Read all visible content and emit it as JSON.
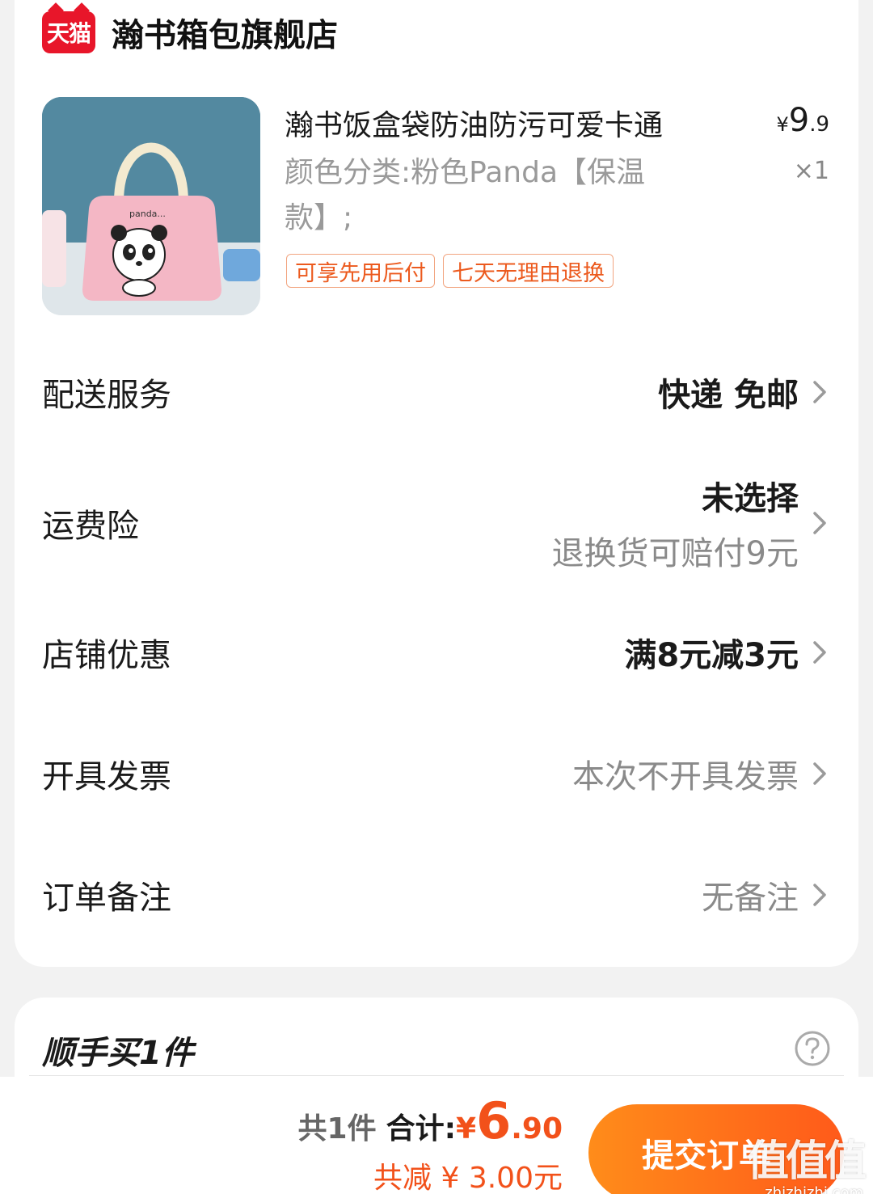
{
  "store": {
    "badge": "天猫",
    "name": "瀚书箱包旗舰店"
  },
  "product": {
    "title": "瀚书饭盒袋防油防污可爱卡通",
    "variant": "颜色分类:粉色Panda【保温款】;",
    "price_symbol": "¥",
    "price_int": "9",
    "price_dec": ".9",
    "quantity": "×1",
    "tags": [
      "可享先用后付",
      "七天无理由退换"
    ]
  },
  "rows": {
    "delivery": {
      "label": "配送服务",
      "value": "快递 免邮"
    },
    "insurance": {
      "label": "运费险",
      "value": "未选择",
      "sub": "退换货可赔付9元"
    },
    "discount": {
      "label": "店铺优惠",
      "value": "满8元减3元"
    },
    "invoice": {
      "label": "开具发票",
      "value": "本次不开具发票"
    },
    "note": {
      "label": "订单备注",
      "value": "无备注"
    }
  },
  "extra": {
    "title": "顺手买1件"
  },
  "footer": {
    "count": "共1件",
    "total_label": "合计:",
    "total_yen": "¥",
    "total_int": "6",
    "total_dec": ".90",
    "discount": "共减 ¥ 3.00元",
    "submit": "提交订单"
  },
  "watermark": {
    "mark": "值值值",
    "site": "zhizhizhi.com"
  },
  "colors": {
    "accent": "#f2511a",
    "tmall_red": "#e8162a",
    "tag_border": "#f2a580"
  },
  "icons": [
    "chevron-right-icon",
    "help-icon",
    "tmall-logo"
  ]
}
